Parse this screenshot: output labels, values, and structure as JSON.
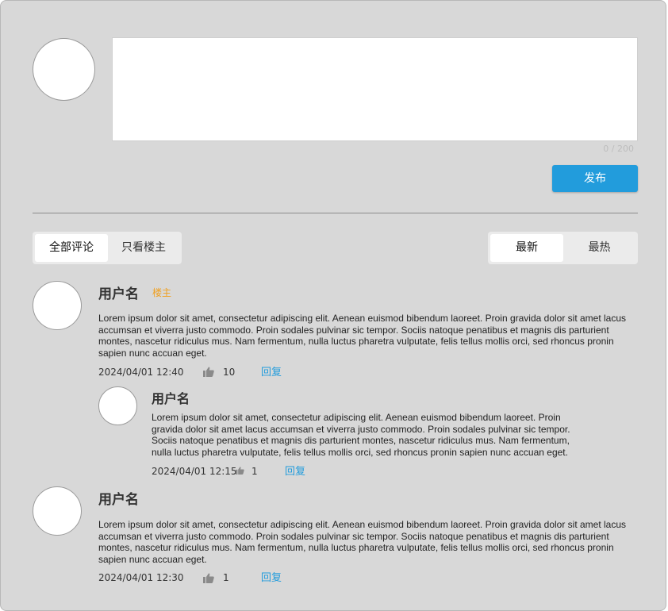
{
  "editor": {
    "counter": "0 / 200",
    "publish_label": "发布"
  },
  "filter_tabs": {
    "all": "全部评论",
    "owner_only": "只看楼主"
  },
  "sort_tabs": {
    "newest": "最新",
    "hottest": "最热"
  },
  "comments": [
    {
      "username": "用户名",
      "badge": "楼主",
      "content": "Lorem ipsum dolor sit amet, consectetur adipiscing elit. Aenean euismod bibendum laoreet. Proin gravida dolor sit amet lacus accumsan et viverra justo commodo. Proin sodales pulvinar sic tempor. Sociis natoque penatibus et magnis dis parturient montes, nascetur ridiculus mus. Nam fermentum, nulla luctus pharetra vulputate, felis tellus mollis orci, sed rhoncus pronin sapien nunc accuan eget.",
      "time": "2024/04/01 12:40",
      "likes": "10",
      "reply_label": "回复",
      "replies": [
        {
          "username": "用户名",
          "content": "Lorem ipsum dolor sit amet, consectetur adipiscing elit. Aenean euismod bibendum laoreet. Proin gravida dolor sit amet lacus accumsan et viverra justo commodo. Proin sodales pulvinar sic tempor. Sociis natoque penatibus et magnis dis parturient montes, nascetur ridiculus mus. Nam fermentum, nulla luctus pharetra vulputate, felis tellus mollis orci, sed rhoncus pronin sapien nunc accuan eget.",
          "time": "2024/04/01 12:15",
          "likes": "1",
          "reply_label": "回复"
        }
      ]
    },
    {
      "username": "用户名",
      "content": "Lorem ipsum dolor sit amet, consectetur adipiscing elit. Aenean euismod bibendum laoreet. Proin gravida dolor sit amet lacus accumsan et viverra justo commodo. Proin sodales pulvinar sic tempor. Sociis natoque penatibus et magnis dis parturient montes, nascetur ridiculus mus. Nam fermentum, nulla luctus pharetra vulputate, felis tellus mollis orci, sed rhoncus pronin sapien nunc accuan eget.",
      "time": "2024/04/01 12:30",
      "likes": "1",
      "reply_label": "回复"
    }
  ],
  "colors": {
    "accent": "#229cdc",
    "badge": "#f0a020",
    "panel": "#d8d8d8"
  }
}
